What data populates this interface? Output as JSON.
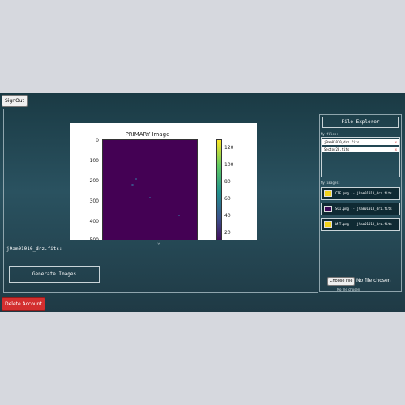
{
  "header": {
    "signout_label": "SignOut"
  },
  "plot": {
    "chart_data": {
      "type": "heatmap",
      "title": "PRIMARY Image",
      "y_ticks": [
        "0",
        "100",
        "200",
        "300",
        "400",
        "500"
      ],
      "colorbar_ticks": [
        "120",
        "100",
        "80",
        "60",
        "40",
        "20"
      ],
      "colormap": "viridis"
    },
    "chevron": "⌄"
  },
  "main": {
    "selected_file_label": "j9am01010_drz.fits:",
    "generate_label": "Generate Images"
  },
  "explorer": {
    "title": "File Explorer",
    "files_label": "My files:",
    "files": [
      {
        "name": "j9am01010_drz.fits",
        "delete": "x"
      },
      {
        "name": "Sector28.fits",
        "delete": "x"
      }
    ],
    "images_label": "My images:",
    "images": [
      {
        "label": "CTE.png -- j9am01010_drz.fits",
        "thumb_color": "#f2d21b"
      },
      {
        "label": "SCI.png -- j9am01010_drz.fits",
        "thumb_color": "#3a0a55"
      },
      {
        "label": "WHT.png -- j9am01010_drz.fits",
        "thumb_color": "#f2d21b"
      }
    ],
    "choose_label": "Choose File",
    "choose_status": "No file chosen",
    "choose_sub": "No file chosen"
  },
  "footer": {
    "delete_label": "Delete Account"
  }
}
